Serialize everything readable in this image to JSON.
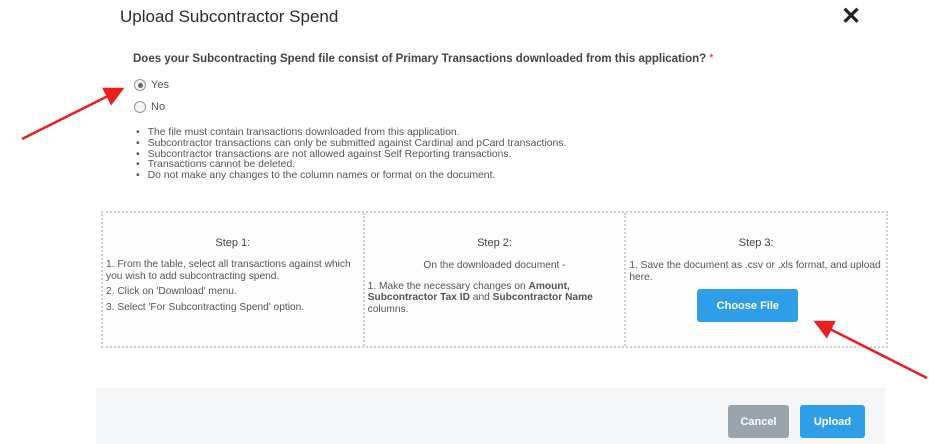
{
  "dialog": {
    "title": "Upload Subcontractor Spend",
    "close_icon": "close-icon",
    "question": "Does your Subcontracting Spend file consist of Primary Transactions downloaded from this application?",
    "required_marker": "*",
    "options": [
      {
        "label": "Yes",
        "selected": true
      },
      {
        "label": "No",
        "selected": false
      }
    ],
    "rules": [
      "The file must contain transactions downloaded from this application.",
      "Subcontractor transactions can only be submitted against Cardinal and pCard transactions.",
      "Subcontractor transactions are not allowed against Self Reporting transactions.",
      "Transactions cannot be deleted.",
      "Do not make any changes to the column names or format on the document."
    ]
  },
  "steps": [
    {
      "title": "Step 1:",
      "lines": [
        "1. From the table, select all transactions against which you wish to add subcontracting spend.",
        "2. Click on 'Download' menu.",
        "3. Select 'For Subcontracting Spend' option."
      ]
    },
    {
      "title": "Step 2:",
      "intro": "On the downloaded document -",
      "text_prefix": "1. Make the necessary changes on ",
      "bold_1": "Amount, Subcontractor Tax ID",
      "text_mid": " and ",
      "bold_2": "Subcontractor Name",
      "text_suffix": " columns."
    },
    {
      "title": "Step 3:",
      "line": "1. Save the document as .csv or .xls format, and upload here.",
      "button": "Choose File"
    }
  ],
  "footer": {
    "cancel": "Cancel",
    "upload": "Upload"
  },
  "colors": {
    "primary": "#2e9ee9",
    "secondary": "#9aa4ad",
    "annotation_arrow": "#e8211c"
  }
}
